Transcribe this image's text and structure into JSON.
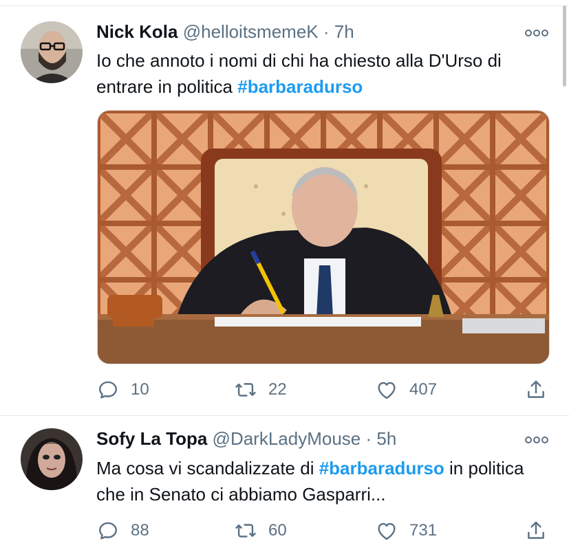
{
  "tweets": [
    {
      "name": "Nick Kola",
      "handle": "@helloitsmemeK",
      "separator": "·",
      "time": "7h",
      "text_before": "Io che annoto i nomi di chi ha chiesto alla D'Urso di entrare in politica ",
      "hashtag": "#barbaradurso",
      "text_after": "",
      "replies": "10",
      "retweets": "22",
      "likes": "407"
    },
    {
      "name": "Sofy La Topa",
      "handle": "@DarkLadyMouse",
      "separator": "·",
      "time": "5h",
      "text_before": "Ma cosa vi scandalizzate di ",
      "hashtag": "#barbaradurso",
      "text_after": " in politica che in Senato ci abbiamo Gasparri...",
      "replies": "88",
      "retweets": "60",
      "likes": "731"
    }
  ],
  "colors": {
    "hashtag": "#1d9bf0",
    "secondary_text": "#5b7083",
    "primary_text": "#0f1419",
    "separator": "#e6e6e6"
  },
  "icons": [
    "reply-icon",
    "retweet-icon",
    "like-icon",
    "share-icon",
    "more-options-icon"
  ]
}
